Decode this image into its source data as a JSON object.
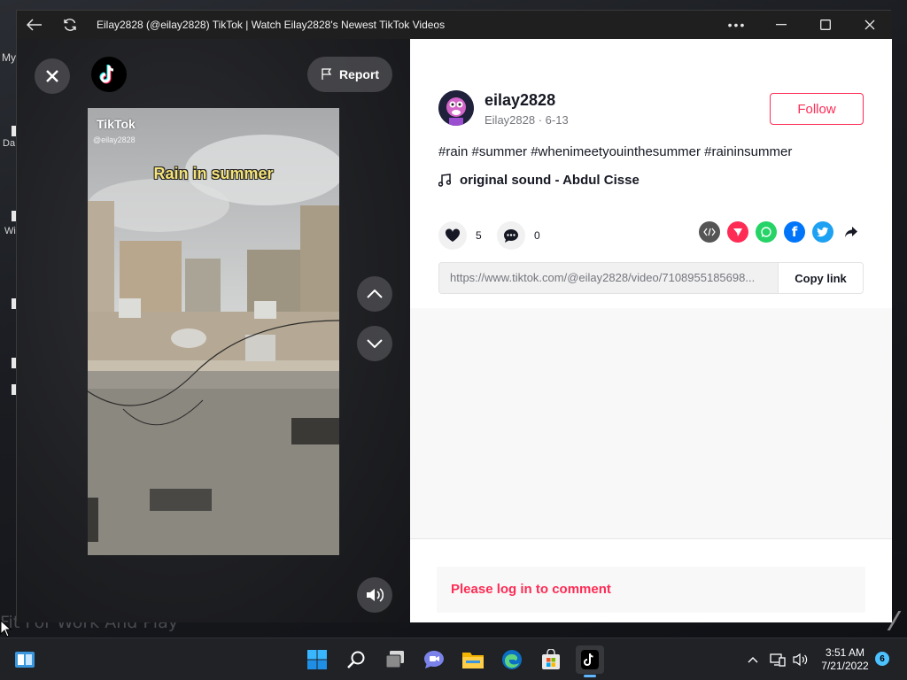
{
  "window": {
    "title": "Eilay2828 (@eilay2828) TikTok | Watch Eilay2828's Newest TikTok Videos"
  },
  "desktop": {
    "fragments": [
      "My",
      "Da",
      "Wi"
    ],
    "wallpaper_text": "Fit For Work And Play"
  },
  "video": {
    "report_label": "Report",
    "watermark": "TikTok",
    "handle": "@eilay2828",
    "caption": "Rain in summer"
  },
  "post": {
    "username": "eilay2828",
    "display_name": "Eilay2828",
    "date": "6-13",
    "follow_label": "Follow",
    "hashtags": "#rain #summer #whenimeetyouinthesummer #raininsummer",
    "sound": "original sound - Abdul Cisse",
    "likes": "5",
    "comments": "0",
    "link": "https://www.tiktok.com/@eilay2828/video/7108955185698...",
    "copy_label": "Copy link",
    "login_prompt": "Please log in to comment"
  },
  "share_icons": [
    {
      "name": "embed-icon",
      "color": "#555555"
    },
    {
      "name": "send-icon",
      "color": "#fe2c55"
    },
    {
      "name": "whatsapp-icon",
      "color": "#25d366"
    },
    {
      "name": "facebook-icon",
      "color": "#0075fa"
    },
    {
      "name": "twitter-icon",
      "color": "#1da1f2"
    },
    {
      "name": "share-arrow-icon",
      "color": "#161823"
    }
  ],
  "taskbar": {
    "time": "3:51 AM",
    "date": "7/21/2022",
    "notifications": "6"
  },
  "colors": {
    "accent": "#fe2c55",
    "text": "#161823",
    "muted": "#75777d"
  }
}
